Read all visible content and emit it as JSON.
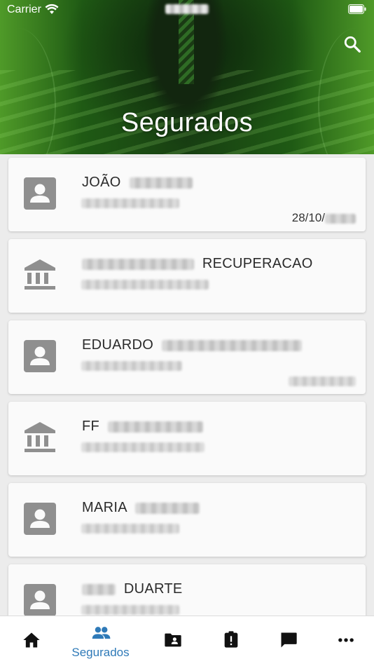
{
  "status_bar": {
    "carrier": "Carrier"
  },
  "header": {
    "title": "Segurados",
    "search_icon": "search-icon"
  },
  "colors": {
    "accent": "#2f7ab8",
    "icon_gray": "#8f8f8f",
    "nav_icon": "#111111",
    "header_green": "#2e6b1e"
  },
  "insured_list": [
    {
      "type": "person",
      "icon": "person-card-icon",
      "name": "JOÃO",
      "date": "28/10/"
    },
    {
      "type": "company",
      "icon": "bank-icon",
      "name": "RECUPERACAO",
      "date": ""
    },
    {
      "type": "person",
      "icon": "person-card-icon",
      "name": "EDUARDO",
      "date": ""
    },
    {
      "type": "company",
      "icon": "bank-icon",
      "name": "FF",
      "date": ""
    },
    {
      "type": "person",
      "icon": "person-card-icon",
      "name": "MARIA",
      "date": ""
    },
    {
      "type": "person",
      "icon": "person-card-icon",
      "name": "DUARTE",
      "date": ""
    }
  ],
  "bottom_nav": {
    "items": [
      {
        "icon": "home-icon",
        "label": "",
        "active": false
      },
      {
        "icon": "people-icon",
        "label": "Segurados",
        "active": true
      },
      {
        "icon": "folder-person-icon",
        "label": "",
        "active": false
      },
      {
        "icon": "clipboard-alert-icon",
        "label": "",
        "active": false
      },
      {
        "icon": "chat-icon",
        "label": "",
        "active": false
      },
      {
        "icon": "more-icon",
        "label": "",
        "active": false
      }
    ]
  }
}
